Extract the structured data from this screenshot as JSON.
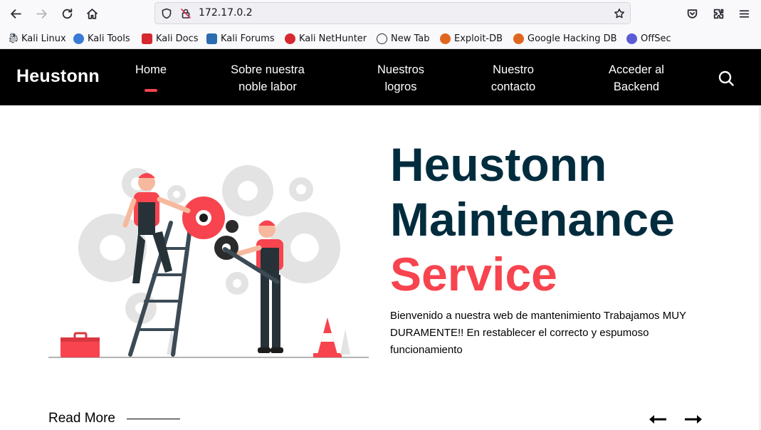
{
  "browser": {
    "url": "172.17.0.2",
    "bookmarks": [
      {
        "label": "Kali Linux",
        "color": "#2f3a4a"
      },
      {
        "label": "Kali Tools",
        "color": "#3a7bd5"
      },
      {
        "label": "Kali Docs",
        "color": "#d6282e"
      },
      {
        "label": "Kali Forums",
        "color": "#2b6cb0"
      },
      {
        "label": "Kali NetHunter",
        "color": "#d6282e"
      },
      {
        "label": "New Tab",
        "color": "#2b2a33"
      },
      {
        "label": "Exploit-DB",
        "color": "#e0661f"
      },
      {
        "label": "Google Hacking DB",
        "color": "#e0661f"
      },
      {
        "label": "OffSec",
        "color": "#5b5bd6"
      }
    ]
  },
  "site": {
    "logo": "Heustonn",
    "nav": [
      {
        "line1": "Home",
        "line2": ""
      },
      {
        "line1": "Sobre nuestra",
        "line2": "noble labor"
      },
      {
        "line1": "Nuestros",
        "line2": "logros"
      },
      {
        "line1": "Nuestro",
        "line2": "contacto"
      },
      {
        "line1": "Acceder al",
        "line2": "Backend"
      }
    ],
    "active_nav": "Home"
  },
  "hero": {
    "title_line1": "Heustonn",
    "title_line2": "Maintenance",
    "title_accent": "Service",
    "description": "Bienvenido a nuestra web de mantenimiento Trabajamos MUY DURAMENTE!! En restablecer el correcto y espumoso funcionamiento",
    "read_more": "Read More"
  },
  "colors": {
    "header_bg": "#000000",
    "accent": "#f7444e",
    "title": "#002c3e"
  }
}
